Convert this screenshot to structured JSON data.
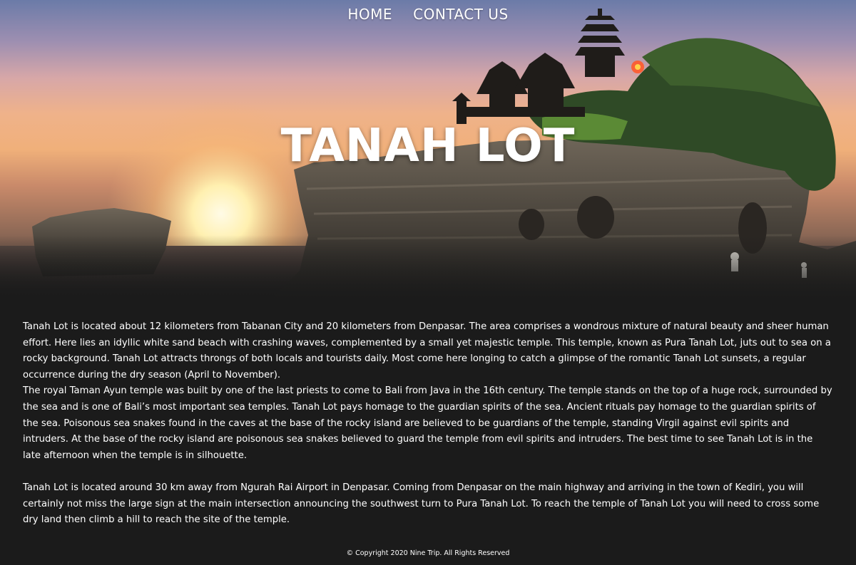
{
  "nav": {
    "home": "HOME",
    "contact": "CONTACT US"
  },
  "hero": {
    "title": "TANAH LOT"
  },
  "content": {
    "p1": "Tanah Lot is located about 12 kilometers from Tabanan City and 20 kilometers from Denpasar. The area comprises a wondrous mixture of natural beauty and sheer human effort. Here lies an idyllic white sand beach with crashing waves, complemented by a small yet majestic temple. This temple, known as Pura Tanah Lot, juts out to sea on a rocky background. Tanah Lot attracts throngs of both locals and tourists daily. Most come here longing to catch a glimpse of the romantic Tanah Lot sunsets, a regular occurrence during the dry season (April to November).",
    "p2": "The royal Taman Ayun temple was built by one of the last priests to come to Bali from Java in the 16th century. The temple stands on the top of a huge rock, surrounded by the sea and is one of Bali’s most important sea temples. Tanah Lot pays homage to the guardian spirits of the sea. Ancient rituals pay homage to the guardian spirits of the sea. Poisonous sea snakes found in the caves at the base of the rocky island are believed to be guardians of the temple, standing Virgil against evil spirits and intruders. At the base of the rocky island are poisonous sea snakes believed to guard the temple from evil spirits and intruders. The best time to see Tanah Lot is in the late afternoon when the temple is in silhouette.",
    "p3": "Tanah Lot is located around 30 km away from Ngurah Rai Airport in Denpasar. Coming from Denpasar on the main highway and arriving in the town of Kediri, you will certainly not miss the large sign at the main intersection announcing the southwest turn to Pura Tanah Lot. To reach the temple of Tanah Lot you will need to cross some dry land then climb a hill to reach the site of the temple."
  },
  "footer": {
    "copyright": "© Copyright 2020 Nine Trip. All Rights Reserved"
  },
  "colors": {
    "page_background": "#1b1b1b",
    "text": "#ffffff"
  }
}
